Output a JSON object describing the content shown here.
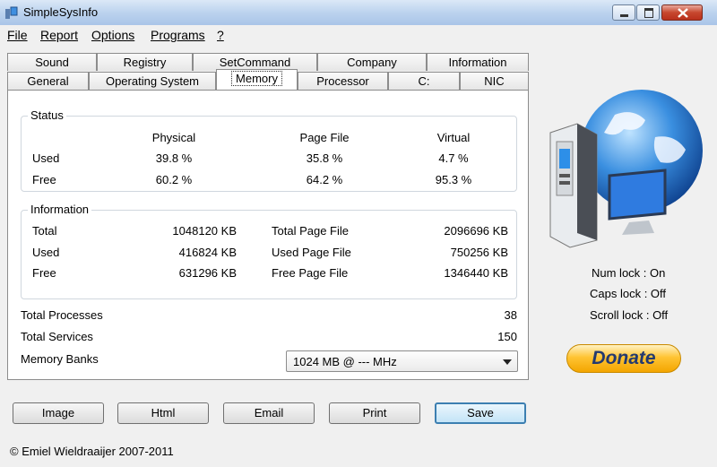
{
  "window": {
    "title": "SimpleSysInfo"
  },
  "menu": [
    "File",
    "Report",
    "Options",
    "Programs",
    "?"
  ],
  "tabs_row1": [
    "Sound",
    "Registry",
    "SetCommand",
    "Company",
    "Information"
  ],
  "tabs_row2": [
    "General",
    "Operating System",
    "Memory",
    "Processor",
    "C:",
    "NIC"
  ],
  "status": {
    "label": "Status",
    "columns": [
      "Physical",
      "Page File",
      "Virtual"
    ],
    "rows": [
      {
        "label": "Used",
        "values": [
          "39.8 %",
          "35.8 %",
          "4.7 %"
        ]
      },
      {
        "label": "Free",
        "values": [
          "60.2 %",
          "64.2 %",
          "95.3 %"
        ]
      }
    ]
  },
  "information": {
    "label": "Information",
    "rows": [
      {
        "label": "Total",
        "value": "1048120 KB",
        "label2": "Total Page File",
        "value2": "2096696 KB"
      },
      {
        "label": "Used",
        "value": "416824 KB",
        "label2": "Used Page File",
        "value2": "750256 KB"
      },
      {
        "label": "Free",
        "value": "631296 KB",
        "label2": "Free Page File",
        "value2": "1346440 KB"
      }
    ]
  },
  "totals": {
    "processes_label": "Total Processes",
    "processes": "38",
    "services_label": "Total Services",
    "services": "150",
    "banks_label": "Memory Banks",
    "banks_value": "1024 MB @ --- MHz"
  },
  "side": {
    "numlock": "Num lock : On",
    "capslock": "Caps lock : Off",
    "scrolllock": "Scroll lock : Off",
    "donate": "Donate"
  },
  "buttons": [
    "Image",
    "Html",
    "Email",
    "Print",
    "Save"
  ],
  "footer": "© Emiel Wieldraaijer 2007-2011",
  "colors": {
    "title_bar": "#bcd3ee",
    "close": "#c7472e",
    "donate": "#ffc433",
    "globe": "#2a6fc4"
  }
}
